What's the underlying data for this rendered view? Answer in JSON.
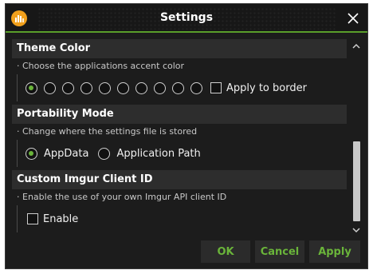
{
  "window": {
    "title": "Settings",
    "accent_color": "#6ab43a",
    "app_icon": "app-logo-icon",
    "close_icon": "close-icon"
  },
  "sections": {
    "theme": {
      "title": "Theme Color",
      "description": "· Choose the applications accent color",
      "swatch_count": 10,
      "selected_index": 0,
      "apply_to_border_label": "Apply to border",
      "apply_to_border_checked": false
    },
    "portability": {
      "title": "Portability Mode",
      "description": "· Change where the settings file is stored",
      "options": [
        "AppData",
        "Application Path"
      ],
      "selected": "AppData"
    },
    "imgur": {
      "title": "Custom Imgur Client ID",
      "description": "· Enable the use of your own Imgur API client ID",
      "enable_label": "Enable",
      "enable_checked": false
    }
  },
  "buttons": {
    "ok": "OK",
    "cancel": "Cancel",
    "apply": "Apply"
  },
  "scrollbar": {
    "up_icon": "chevron-up-icon",
    "down_icon": "chevron-down-icon"
  }
}
